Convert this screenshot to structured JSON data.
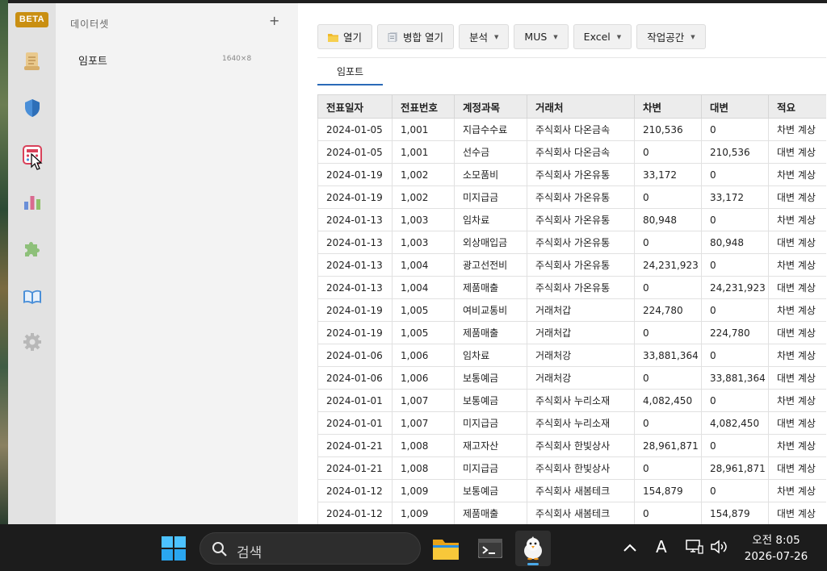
{
  "rail": {
    "badge": "BETA",
    "icons": [
      "scroll-icon",
      "shield-icon",
      "calculator-icon",
      "bar-chart-icon",
      "puzzle-icon",
      "book-icon",
      "gear-icon"
    ]
  },
  "panel": {
    "title": "데이터셋",
    "add_label": "+",
    "dataset": {
      "name": "임포트",
      "size": "1640×8"
    }
  },
  "toolbar": {
    "open": "열기",
    "merge_open": "병합 열기",
    "analysis": "분석",
    "mus": "MUS",
    "excel": "Excel",
    "workspace": "작업공간"
  },
  "tabs": [
    {
      "label": "임포트"
    }
  ],
  "table": {
    "columns": [
      "전표일자",
      "전표번호",
      "계정과목",
      "거래처",
      "차변",
      "대변",
      "적요"
    ],
    "rows": [
      [
        "2024-01-05",
        "1,001",
        "지급수수료",
        "주식회사 다온금속",
        "210,536",
        "0",
        "차변 계상"
      ],
      [
        "2024-01-05",
        "1,001",
        "선수금",
        "주식회사 다온금속",
        "0",
        "210,536",
        "대변 계상"
      ],
      [
        "2024-01-19",
        "1,002",
        "소모품비",
        "주식회사 가온유통",
        "33,172",
        "0",
        "차변 계상"
      ],
      [
        "2024-01-19",
        "1,002",
        "미지급금",
        "주식회사 가온유통",
        "0",
        "33,172",
        "대변 계상"
      ],
      [
        "2024-01-13",
        "1,003",
        "임차료",
        "주식회사 가온유통",
        "80,948",
        "0",
        "차변 계상"
      ],
      [
        "2024-01-13",
        "1,003",
        "외상매입금",
        "주식회사 가온유통",
        "0",
        "80,948",
        "대변 계상"
      ],
      [
        "2024-01-13",
        "1,004",
        "광고선전비",
        "주식회사 가온유통",
        "24,231,923",
        "0",
        "차변 계상"
      ],
      [
        "2024-01-13",
        "1,004",
        "제품매출",
        "주식회사 가온유통",
        "0",
        "24,231,923",
        "대변 계상"
      ],
      [
        "2024-01-19",
        "1,005",
        "여비교통비",
        "거래처갑",
        "224,780",
        "0",
        "차변 계상"
      ],
      [
        "2024-01-19",
        "1,005",
        "제품매출",
        "거래처갑",
        "0",
        "224,780",
        "대변 계상"
      ],
      [
        "2024-01-06",
        "1,006",
        "임차료",
        "거래처강",
        "33,881,364",
        "0",
        "차변 계상"
      ],
      [
        "2024-01-06",
        "1,006",
        "보통예금",
        "거래처강",
        "0",
        "33,881,364",
        "대변 계상"
      ],
      [
        "2024-01-01",
        "1,007",
        "보통예금",
        "주식회사 누리소재",
        "4,082,450",
        "0",
        "차변 계상"
      ],
      [
        "2024-01-01",
        "1,007",
        "미지급금",
        "주식회사 누리소재",
        "0",
        "4,082,450",
        "대변 계상"
      ],
      [
        "2024-01-21",
        "1,008",
        "재고자산",
        "주식회사 한빛상사",
        "28,961,871",
        "0",
        "차변 계상"
      ],
      [
        "2024-01-21",
        "1,008",
        "미지급금",
        "주식회사 한빛상사",
        "0",
        "28,961,871",
        "대변 계상"
      ],
      [
        "2024-01-12",
        "1,009",
        "보통예금",
        "주식회사 새봄테크",
        "154,879",
        "0",
        "차변 계상"
      ],
      [
        "2024-01-12",
        "1,009",
        "제품매출",
        "주식회사 새봄테크",
        "0",
        "154,879",
        "대변 계상"
      ]
    ]
  },
  "taskbar": {
    "search_placeholder": "검색",
    "ime": "A",
    "time": "오전 8:05",
    "date": "2026-07-26"
  },
  "colors": {
    "accent": "#2a6ab8",
    "badge": "#c98f12"
  }
}
